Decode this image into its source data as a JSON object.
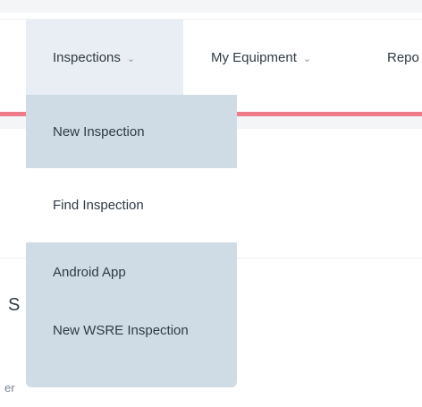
{
  "nav": {
    "items": [
      {
        "label": "Inspections",
        "chevron": "chevron-down-icon",
        "active": true
      },
      {
        "label": "My Equipment",
        "chevron": "chevron-down-icon",
        "active": false
      },
      {
        "label": "Repo",
        "active": false
      }
    ]
  },
  "dropdown": {
    "items": [
      {
        "label": "New Inspection"
      },
      {
        "label": "Find Inspection"
      },
      {
        "label": "Android App"
      },
      {
        "label": "New WSRE Inspection"
      }
    ]
  },
  "page": {
    "heading_fragment": "S",
    "label_fragment": "er"
  },
  "colors": {
    "accent": "#ef7a8a",
    "menu_bg": "#cfdce6",
    "active_nav_bg": "#e8eef3",
    "text": "#2f3a44"
  }
}
